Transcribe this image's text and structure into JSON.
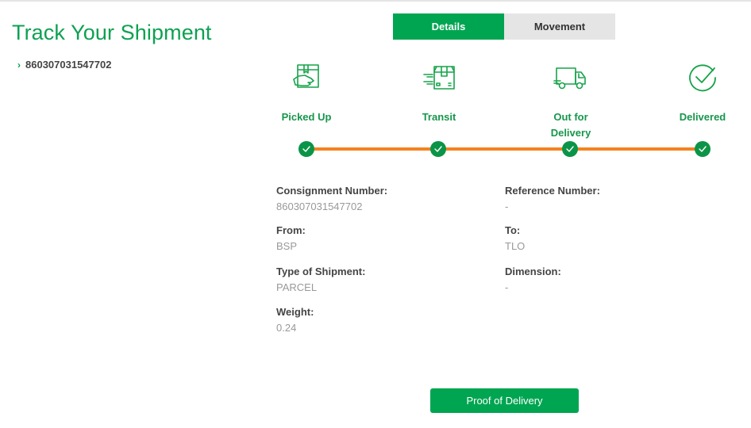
{
  "header": {
    "title": "Track Your Shipment"
  },
  "sidebar": {
    "shipments": [
      {
        "number": "860307031547702"
      }
    ]
  },
  "tabs": [
    {
      "label": "Details",
      "active": true
    },
    {
      "label": "Movement",
      "active": false
    }
  ],
  "progress": {
    "stages": [
      {
        "label": "Picked Up",
        "icon": "hand-box-icon",
        "completed": true
      },
      {
        "label": "Transit",
        "icon": "moving-box-icon",
        "completed": true
      },
      {
        "label": "Out for Delivery",
        "icon": "delivery-truck-icon",
        "completed": true
      },
      {
        "label": "Delivered",
        "icon": "check-circle-icon",
        "completed": true
      }
    ],
    "line_color": "#f58220",
    "dot_color": "#0b9447"
  },
  "details": {
    "consignment_number": {
      "label": "Consignment Number:",
      "value": "860307031547702"
    },
    "reference_number": {
      "label": "Reference Number:",
      "value": "-"
    },
    "from": {
      "label": "From:",
      "value": "BSP"
    },
    "to": {
      "label": "To:",
      "value": "TLO"
    },
    "type_of_shipment": {
      "label": "Type of Shipment:",
      "value": "PARCEL"
    },
    "dimension": {
      "label": "Dimension:",
      "value": "-"
    },
    "weight": {
      "label": "Weight:",
      "value": "0.24"
    }
  },
  "actions": {
    "proof_of_delivery": "Proof of Delivery"
  },
  "colors": {
    "brand_green": "#00a551",
    "title_green": "#0ea152",
    "accent_orange": "#f58220"
  }
}
